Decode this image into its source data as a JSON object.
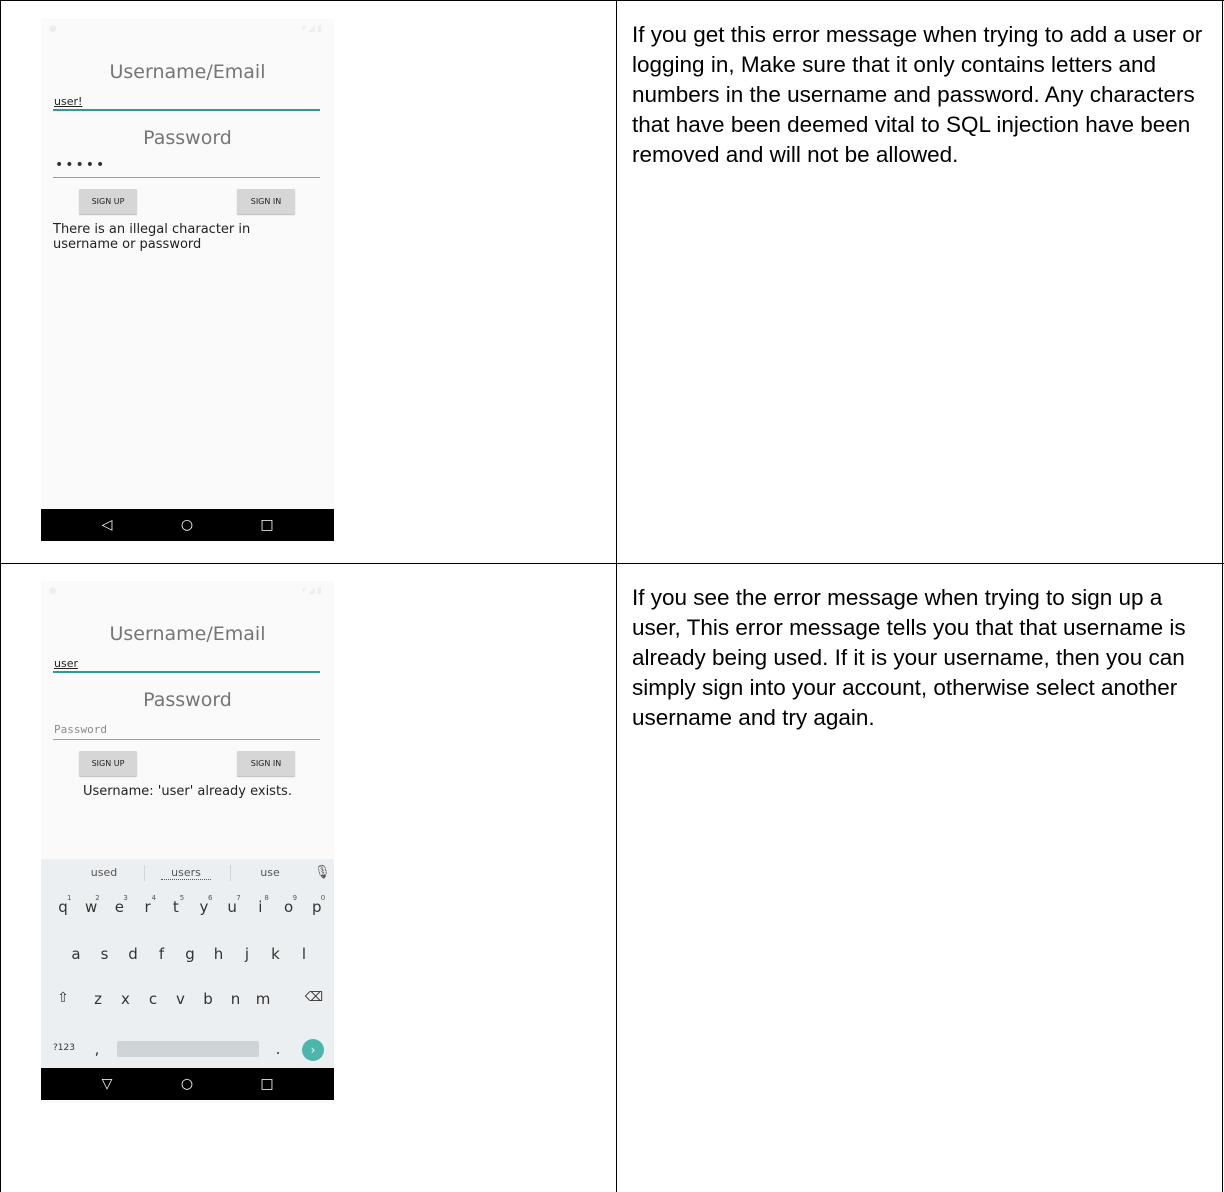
{
  "rows": [
    {
      "phone": {
        "username_title": "Username/Email",
        "username_value": "user!",
        "password_title": "Password",
        "password_value": "•••••",
        "signup_label": "SIGN UP",
        "signin_label": "SIGN IN",
        "error_line1": "There is an illegal character in",
        "error_line2": "username or password"
      },
      "description": "If you get this error message when trying to add a user or logging in, Make sure that it only contains letters and numbers in the username and password. Any characters that have been deemed vital to SQL injection have been removed and will not be allowed."
    },
    {
      "phone": {
        "username_title": "Username/Email",
        "username_value": "user",
        "password_title": "Password",
        "password_placeholder": "Password",
        "signup_label": "SIGN UP",
        "signin_label": "SIGN IN",
        "error_line1": "Username: 'user' already exists."
      },
      "keyboard": {
        "suggestions": [
          "used",
          "users",
          "use"
        ],
        "row1": [
          "q",
          "w",
          "e",
          "r",
          "t",
          "y",
          "u",
          "i",
          "o",
          "p"
        ],
        "row1_hints": [
          "1",
          "2",
          "3",
          "4",
          "5",
          "6",
          "7",
          "8",
          "9",
          "0"
        ],
        "row2": [
          "a",
          "s",
          "d",
          "f",
          "g",
          "h",
          "j",
          "k",
          "l"
        ],
        "row3": [
          "z",
          "x",
          "c",
          "v",
          "b",
          "n",
          "m"
        ],
        "symbols_key": "?123",
        "comma_key": ",",
        "period_key": "."
      },
      "description": "If you see the error message when trying to sign up a user, This error message tells you that that username is already being used. If it is your username, then you can simply sign into your account, otherwise select another username and try again."
    }
  ],
  "icons": {
    "back": "back-triangle-icon",
    "home": "home-circle-icon",
    "recents": "recents-square-icon",
    "shift": "shift-arrow-icon",
    "backspace": "backspace-icon",
    "mic": "microphone-icon",
    "go": "go-arrow-icon"
  },
  "colors": {
    "accent": "#2a9d8f",
    "go_key": "#4db6ac"
  }
}
